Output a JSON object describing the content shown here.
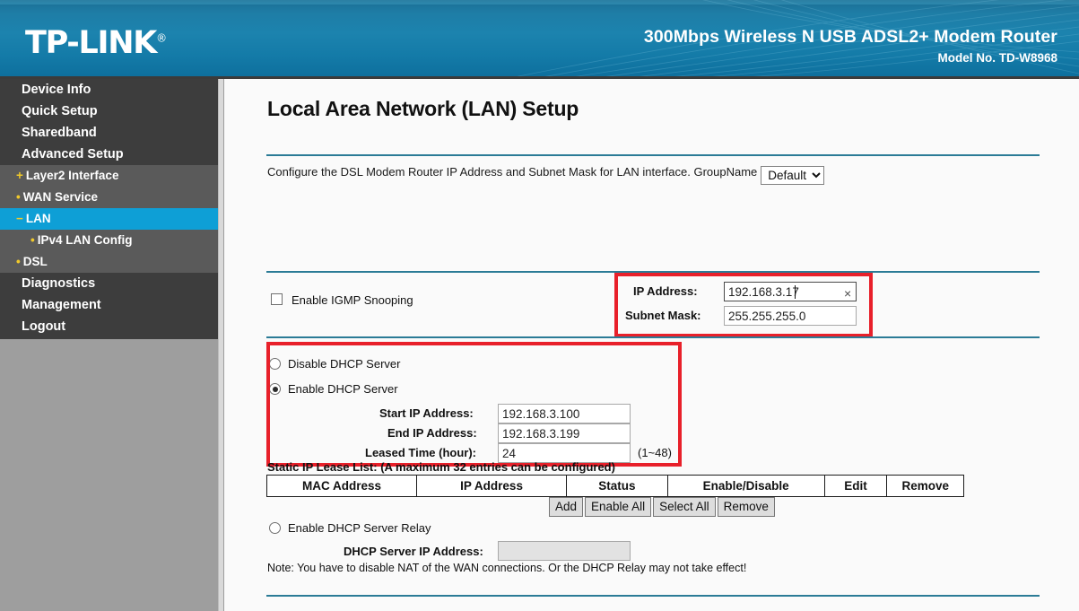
{
  "header": {
    "logo": "TP-LINK",
    "logo_trademark": "®",
    "product_title": "300Mbps Wireless N USB ADSL2+ Modem Router",
    "model": "Model No. TD-W8968",
    "brand_color": "#1c83ae"
  },
  "sidebar": {
    "highlight_color": "#0e9fd6",
    "marker_color": "#f0c92b",
    "items": [
      {
        "label": "Device Info",
        "level": "top",
        "marker": "",
        "active": false
      },
      {
        "label": "Quick Setup",
        "level": "top",
        "marker": "",
        "active": false
      },
      {
        "label": "Sharedband",
        "level": "top",
        "marker": "",
        "active": false
      },
      {
        "label": "Advanced Setup",
        "level": "top",
        "marker": "",
        "active": false
      },
      {
        "label": "Layer2 Interface",
        "level": "sub",
        "marker": "+",
        "active": false
      },
      {
        "label": "WAN Service",
        "level": "sub",
        "marker": "•",
        "active": false
      },
      {
        "label": "LAN",
        "level": "sub",
        "marker": "−",
        "active": true
      },
      {
        "label": "IPv4 LAN Config",
        "level": "sub2",
        "marker": "•",
        "active": false
      },
      {
        "label": "DSL",
        "level": "sub",
        "marker": "•",
        "active": false
      },
      {
        "label": "Diagnostics",
        "level": "top",
        "marker": "",
        "active": false
      },
      {
        "label": "Management",
        "level": "top",
        "marker": "",
        "active": false
      },
      {
        "label": "Logout",
        "level": "top",
        "marker": "",
        "active": false
      }
    ]
  },
  "main": {
    "page_title": "Local Area Network (LAN) Setup",
    "description": "Configure the DSL Modem Router IP Address and Subnet Mask for LAN interface.  GroupName",
    "groupname": {
      "selected": "Default",
      "options": [
        "Default"
      ]
    },
    "lan": {
      "ip_address_label": "IP Address:",
      "ip_address_value": "192.168.3.17",
      "clear_icon": "×",
      "subnet_mask_label": "Subnet Mask:",
      "subnet_mask_value": "255.255.255.0"
    },
    "igmp": {
      "label": "Enable IGMP Snooping",
      "checked": false
    },
    "dhcp": {
      "disable_label": "Disable DHCP Server",
      "disable_selected": false,
      "enable_label": "Enable DHCP Server",
      "enable_selected": true,
      "start_ip_label": "Start IP Address:",
      "start_ip_value": "192.168.3.100",
      "end_ip_label": "End IP Address:",
      "end_ip_value": "192.168.3.199",
      "leased_time_label": "Leased Time (hour):",
      "leased_time_value": "24",
      "leased_time_hint": "(1~48)"
    },
    "static_lease": {
      "caption": "Static IP Lease List: (A maximum 32 entries can be configured)",
      "columns": [
        "MAC Address",
        "IP Address",
        "Status",
        "Enable/Disable",
        "Edit",
        "Remove"
      ],
      "rows": [],
      "buttons": [
        "Add",
        "Enable All",
        "Select All",
        "Remove"
      ]
    },
    "dhcp_relay": {
      "label": "Enable DHCP Server Relay",
      "selected": false,
      "server_ip_label": "DHCP Server IP Address:",
      "server_ip_value": "",
      "server_ip_disabled": true,
      "note": "Note: You have to disable NAT of the WAN connections. Or the DHCP Relay may not take effect!"
    }
  },
  "annotations": {
    "highlight_color": "#e8202a",
    "boxes": [
      "lan-ip-settings",
      "dhcp-server-settings"
    ]
  }
}
